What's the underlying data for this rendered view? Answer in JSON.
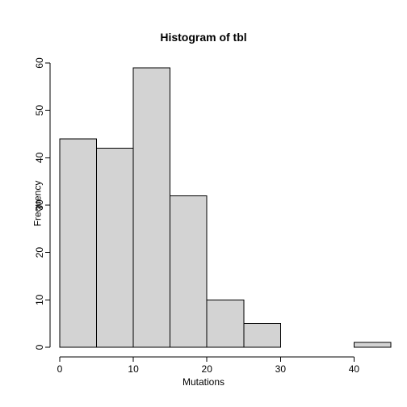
{
  "chart_data": {
    "type": "bar",
    "title": "Histogram of tbl",
    "xlabel": "Mutations",
    "ylabel": "Frequency",
    "bin_edges": [
      0,
      5,
      10,
      15,
      20,
      25,
      30,
      35,
      40,
      45
    ],
    "values": [
      44,
      42,
      59,
      32,
      10,
      5,
      0,
      0,
      1
    ],
    "xticks": [
      0,
      10,
      20,
      30,
      40
    ],
    "yticks": [
      0,
      10,
      20,
      30,
      40,
      50,
      60
    ],
    "xlim": [
      0,
      45
    ],
    "ylim": [
      0,
      60
    ]
  }
}
